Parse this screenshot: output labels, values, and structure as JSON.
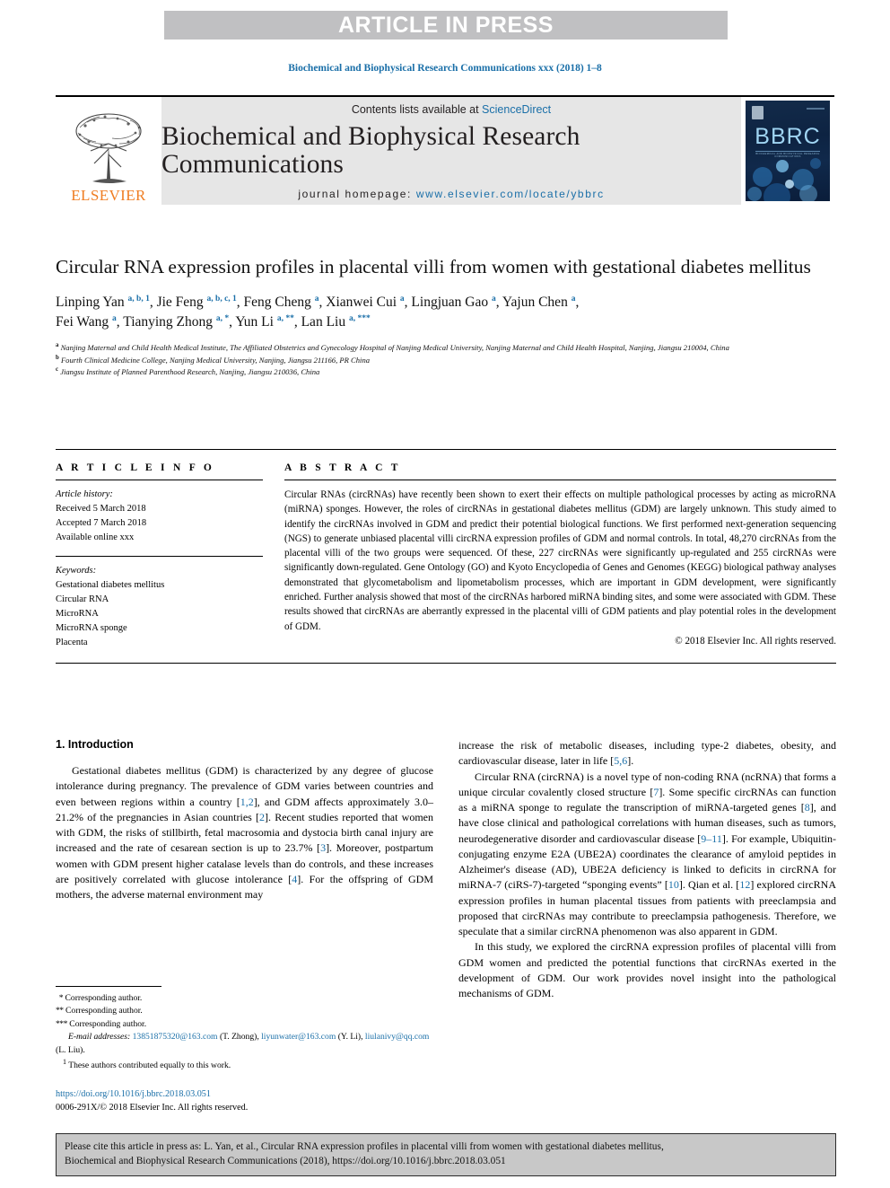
{
  "banner": {
    "text": "ARTICLE IN PRESS"
  },
  "running_head": "Biochemical and Biophysical Research Communications xxx (2018) 1–8",
  "masthead": {
    "elsevier_wordmark": "ELSEVIER",
    "contents_prefix": "Contents lists available at ",
    "contents_link": "ScienceDirect",
    "journal_title": "Biochemical and Biophysical Research Communications",
    "homepage_prefix": "journal homepage: ",
    "homepage_url": "www.elsevier.com/locate/ybbrc",
    "cover_label": "BBRC",
    "cover_sub": "BIOCHEMICAL AND BIOPHYSICAL RESEARCH COMMUNICATIONS"
  },
  "article": {
    "title": "Circular RNA expression profiles in placental villi from women with gestational diabetes mellitus",
    "authors_line1_html": "Linping Yan <sup>a, b, 1</sup>, Jie Feng <sup>a, b, c, 1</sup>, Feng Cheng <sup>a</sup>, Xianwei Cui <sup>a</sup>, Lingjuan Gao <sup>a</sup>, Yajun Chen <sup>a</sup>,",
    "authors_line2_html": "Fei Wang <sup>a</sup>, Tianying Zhong <sup>a, *</sup>, Yun Li <sup>a, **</sup>, Lan Liu <sup>a, ***</sup>",
    "affiliations": [
      "Nanjing Maternal and Child Health Medical Institute, The Affiliated Obstetrics and Gynecology Hospital of Nanjing Medical University, Nanjing Maternal and Child Health Hospital, Nanjing, Jiangsu 210004, China",
      "Fourth Clinical Medicine College, Nanjing Medical University, Nanjing, Jiangsu 211166, PR China",
      "Jiangsu Institute of Planned Parenthood Research, Nanjing, Jiangsu 210036, China"
    ],
    "affiliation_markers": [
      "a",
      "b",
      "c"
    ]
  },
  "article_info": {
    "heading": "A R T I C L E  I N F O",
    "history_label": "Article history:",
    "history": [
      "Received 5 March 2018",
      "Accepted 7 March 2018",
      "Available online xxx"
    ],
    "keywords_label": "Keywords:",
    "keywords": [
      "Gestational diabetes mellitus",
      "Circular RNA",
      "MicroRNA",
      "MicroRNA sponge",
      "Placenta"
    ]
  },
  "abstract": {
    "heading": "A B S T R A C T",
    "text": "Circular RNAs (circRNAs) have recently been shown to exert their effects on multiple pathological processes by acting as microRNA (miRNA) sponges. However, the roles of circRNAs in gestational diabetes mellitus (GDM) are largely unknown. This study aimed to identify the circRNAs involved in GDM and predict their potential biological functions. We first performed next-generation sequencing (NGS) to generate unbiased placental villi circRNA expression profiles of GDM and normal controls. In total, 48,270 circRNAs from the placental villi of the two groups were sequenced. Of these, 227 circRNAs were significantly up-regulated and 255 circRNAs were significantly down-regulated. Gene Ontology (GO) and Kyoto Encyclopedia of Genes and Genomes (KEGG) biological pathway analyses demonstrated that glycometabolism and lipometabolism processes, which are important in GDM development, were significantly enriched. Further analysis showed that most of the circRNAs harbored miRNA binding sites, and some were associated with GDM. These results showed that circRNAs are aberrantly expressed in the placental villi of GDM patients and play potential roles in the development of GDM.",
    "copyright": "© 2018 Elsevier Inc. All rights reserved."
  },
  "intro": {
    "heading": "1.  Introduction",
    "left_paragraph_html": "Gestational diabetes mellitus (GDM) is characterized by any degree of glucose intolerance during pregnancy. The prevalence of GDM varies between countries and even between regions within a country [<span class=\"ref\">1,2</span>], and GDM affects approximately 3.0–21.2% of the pregnancies in Asian countries [<span class=\"ref\">2</span>]. Recent studies reported that women with GDM, the risks of stillbirth, fetal macrosomia and dystocia birth canal injury are increased and the rate of cesarean section is up to 23.7% [<span class=\"ref\">3</span>]. Moreover, postpartum women with GDM present higher catalase levels than do controls, and these increases are positively correlated with glucose intolerance [<span class=\"ref\">4</span>]. For the offspring of GDM mothers, the adverse maternal environment may",
    "right_paragraph_1_html": "increase the risk of metabolic diseases, including type-2 diabetes, obesity, and cardiovascular disease, later in life [<span class=\"ref\">5,6</span>].",
    "right_paragraph_2_html": "Circular RNA (circRNA) is a novel type of non-coding RNA (ncRNA) that forms a unique circular covalently closed structure [<span class=\"ref\">7</span>]. Some specific circRNAs can function as a miRNA sponge to regulate the transcription of miRNA-targeted genes [<span class=\"ref\">8</span>], and have close clinical and pathological correlations with human diseases, such as tumors, neurodegenerative disorder and cardiovascular disease [<span class=\"ref\">9–11</span>]. For example, Ubiquitin-conjugating enzyme E2A (UBE2A) coordinates the clearance of amyloid peptides in Alzheimer's disease (AD), UBE2A deficiency is linked to deficits in circRNA for miRNA-7 (ciRS-7)-targeted “sponging events” [<span class=\"ref\">10</span>]. Qian et al. [<span class=\"ref\">12</span>] explored circRNA expression profiles in human placental tissues from patients with preeclampsia and proposed that circRNAs may contribute to preeclampsia pathogenesis. Therefore, we speculate that a similar circRNA phenomenon was also apparent in GDM.",
    "right_paragraph_3_html": "In this study, we explored the circRNA expression profiles of placental villi from GDM women and predicted the potential functions that circRNAs exerted in the development of GDM. Our work provides novel insight into the pathological mechanisms of GDM."
  },
  "footnotes": {
    "corresponding_1": "Corresponding author.",
    "corresponding_2": "Corresponding author.",
    "corresponding_3": "Corresponding author.",
    "email_label": "E-mail addresses:",
    "emails": [
      {
        "address": "13851875320@163.com",
        "owner": "(T. Zhong)"
      },
      {
        "address": "liyunwater@163.com",
        "owner": "(Y. Li)"
      },
      {
        "address": "liulanivy@qq.com",
        "owner": "(L. Liu)"
      }
    ],
    "equal_contribution_marker": "1",
    "equal_contribution": "These authors contributed equally to this work.",
    "doi": "https://doi.org/10.1016/j.bbrc.2018.03.051",
    "issn_copyright": "0006-291X/© 2018 Elsevier Inc. All rights reserved."
  },
  "cite_box": {
    "line1": "Please cite this article in press as: L. Yan, et al., Circular RNA expression profiles in placental villi from women with gestational diabetes mellitus,",
    "line2": "Biochemical and Biophysical Research Communications (2018), https://doi.org/10.1016/j.bbrc.2018.03.051"
  },
  "colors": {
    "link_blue": "#1a6fa8",
    "banner_gray": "#c0c0c2",
    "masthead_gray": "#e6e6e6",
    "cite_box_gray": "#c8c8c8",
    "elsevier_orange": "#ef7d22"
  }
}
